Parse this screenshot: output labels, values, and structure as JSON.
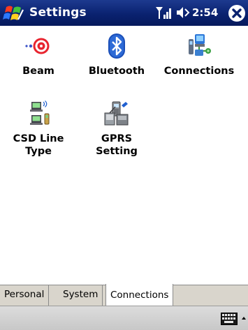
{
  "titlebar": {
    "title": "Settings",
    "time": "2:54",
    "icons": [
      "windows-start-icon",
      "signal-icon",
      "speaker-icon",
      "close-icon"
    ]
  },
  "items": [
    {
      "label": "Beam",
      "icon": "beam-icon"
    },
    {
      "label": "Bluetooth",
      "icon": "bluetooth-icon"
    },
    {
      "label": "Connections",
      "icon": "connections-icon"
    },
    {
      "label": "CSD Line Type",
      "line1": "CSD Line",
      "line2": "Type",
      "icon": "csd-line-type-icon"
    },
    {
      "label": "GPRS Setting",
      "line1": "GPRS",
      "line2": "Setting",
      "icon": "gprs-setting-icon"
    }
  ],
  "tabs": [
    {
      "label": "Personal",
      "active": false
    },
    {
      "label": "System",
      "active": false
    },
    {
      "label": "Connections",
      "active": true
    }
  ],
  "menubar": {
    "icons": [
      "keyboard-icon",
      "sip-arrow-icon"
    ]
  },
  "colors": {
    "titlebar": "#0a2270",
    "tab_strip": "#d9d5cc",
    "menubar": "#cfcfcf"
  }
}
